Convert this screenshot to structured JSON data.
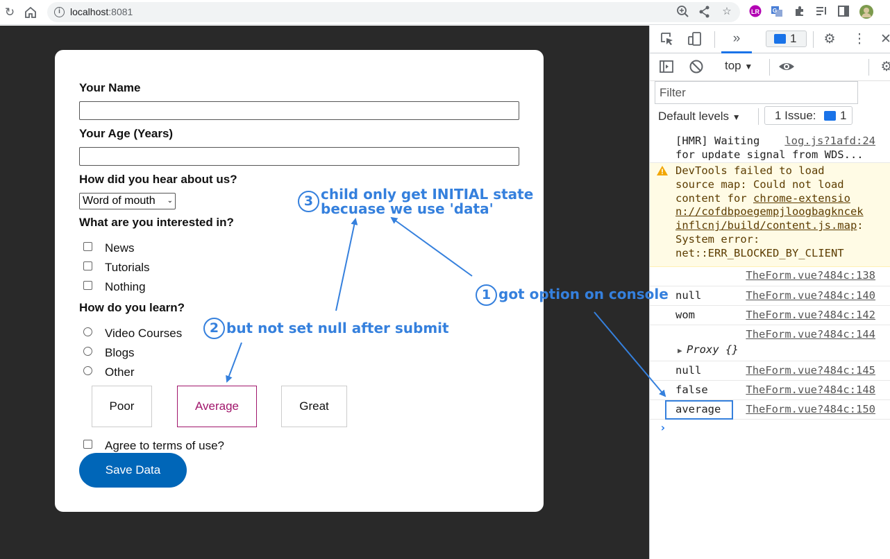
{
  "browser": {
    "url_host": "localhost",
    "url_port": ":8081"
  },
  "form": {
    "name_label": "Your Name",
    "age_label": "Your Age (Years)",
    "referrer_label": "How did you hear about us?",
    "referrer_value": "Word of mouth",
    "interest_label": "What are you interested in?",
    "interests": [
      "News",
      "Tutorials",
      "Nothing"
    ],
    "learn_label": "How do you learn?",
    "learning": [
      "Video Courses",
      "Blogs",
      "Other"
    ],
    "ratings": [
      "Poor",
      "Average",
      "Great"
    ],
    "rating_selected": "Average",
    "terms_label": "Agree to terms of use?",
    "save_label": "Save Data"
  },
  "annotations": {
    "a1_num": "1",
    "a1_text": "got option on console",
    "a2_num": "2",
    "a2_text": "but not set null after submit",
    "a3_num": "3",
    "a3_line1": "child only get INITIAL state",
    "a3_line2": "becuase we use 'data'"
  },
  "devtools": {
    "frame": "top",
    "issue_count": "1",
    "filter_placeholder": "Filter",
    "levels": "Default levels",
    "issues_label": "1 Issue:",
    "issues_count": "1",
    "console": {
      "hmr_msg_line1": "[HMR] Waiting",
      "hmr_msg_line2": "for update signal from WDS...",
      "hmr_src": "log.js?1afd:24",
      "warn_line1": "DevTools failed to load",
      "warn_line2": "source map: Could not load",
      "warn_line3_pre": "content for ",
      "warn_line3_link": "chrome-extensio",
      "warn_line4": "n://cofdbpoegempjloogbagkncek",
      "warn_line5": "inflcnj/build/content.js.map",
      "warn_line5_colon": ":",
      "warn_line6": "System error:",
      "warn_line7": "net::ERR_BLOCKED_BY_CLIENT",
      "rows": [
        {
          "msg": "",
          "src": "TheForm.vue?484c:138"
        },
        {
          "msg": "null",
          "src": "TheForm.vue?484c:140"
        },
        {
          "msg": "wom",
          "src": "TheForm.vue?484c:142"
        },
        {
          "msg": "",
          "src": "TheForm.vue?484c:144"
        },
        {
          "msg": "null",
          "src": "TheForm.vue?484c:145"
        },
        {
          "msg": "false",
          "src": "TheForm.vue?484c:148"
        },
        {
          "msg": "average",
          "src": "TheForm.vue?484c:150"
        }
      ],
      "proxy": "Proxy {}",
      "prompt": "›"
    }
  }
}
